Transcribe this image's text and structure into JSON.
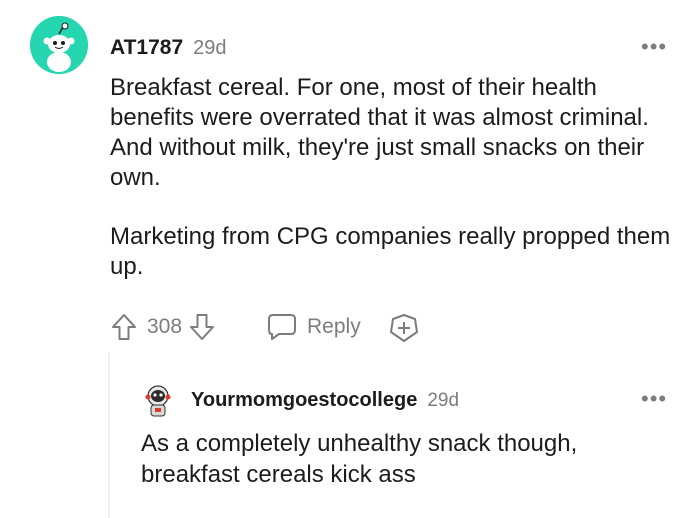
{
  "comment": {
    "username": "AT1787",
    "time": "29d",
    "more": "•••",
    "paragraphs": [
      "Breakfast cereal. For one, most of their health benefits were overrated that it was almost criminal. And without milk, they're just small snacks on their own.",
      "Marketing from CPG companies really propped them up."
    ],
    "score": "308",
    "reply_label": "Reply",
    "icons": {
      "avatar": "snoo-avatar-icon",
      "upvote": "arrow-up-icon",
      "downvote": "arrow-down-icon",
      "reply": "speech-bubble-icon",
      "award": "plus-award-icon",
      "more": "more-dots-icon"
    }
  },
  "reply": {
    "username": "Yourmomgoestocollege",
    "time": "29d",
    "more": "•••",
    "text": "As a completely unhealthy snack though, breakfast cereals kick ass",
    "icons": {
      "avatar": "astronaut-avatar-icon",
      "more": "more-dots-icon"
    }
  },
  "colors": {
    "avatar_bg": "#26d6b0",
    "text": "#1c1c1c",
    "meta": "#7c7c7c",
    "thread_line": "#edeff1"
  }
}
